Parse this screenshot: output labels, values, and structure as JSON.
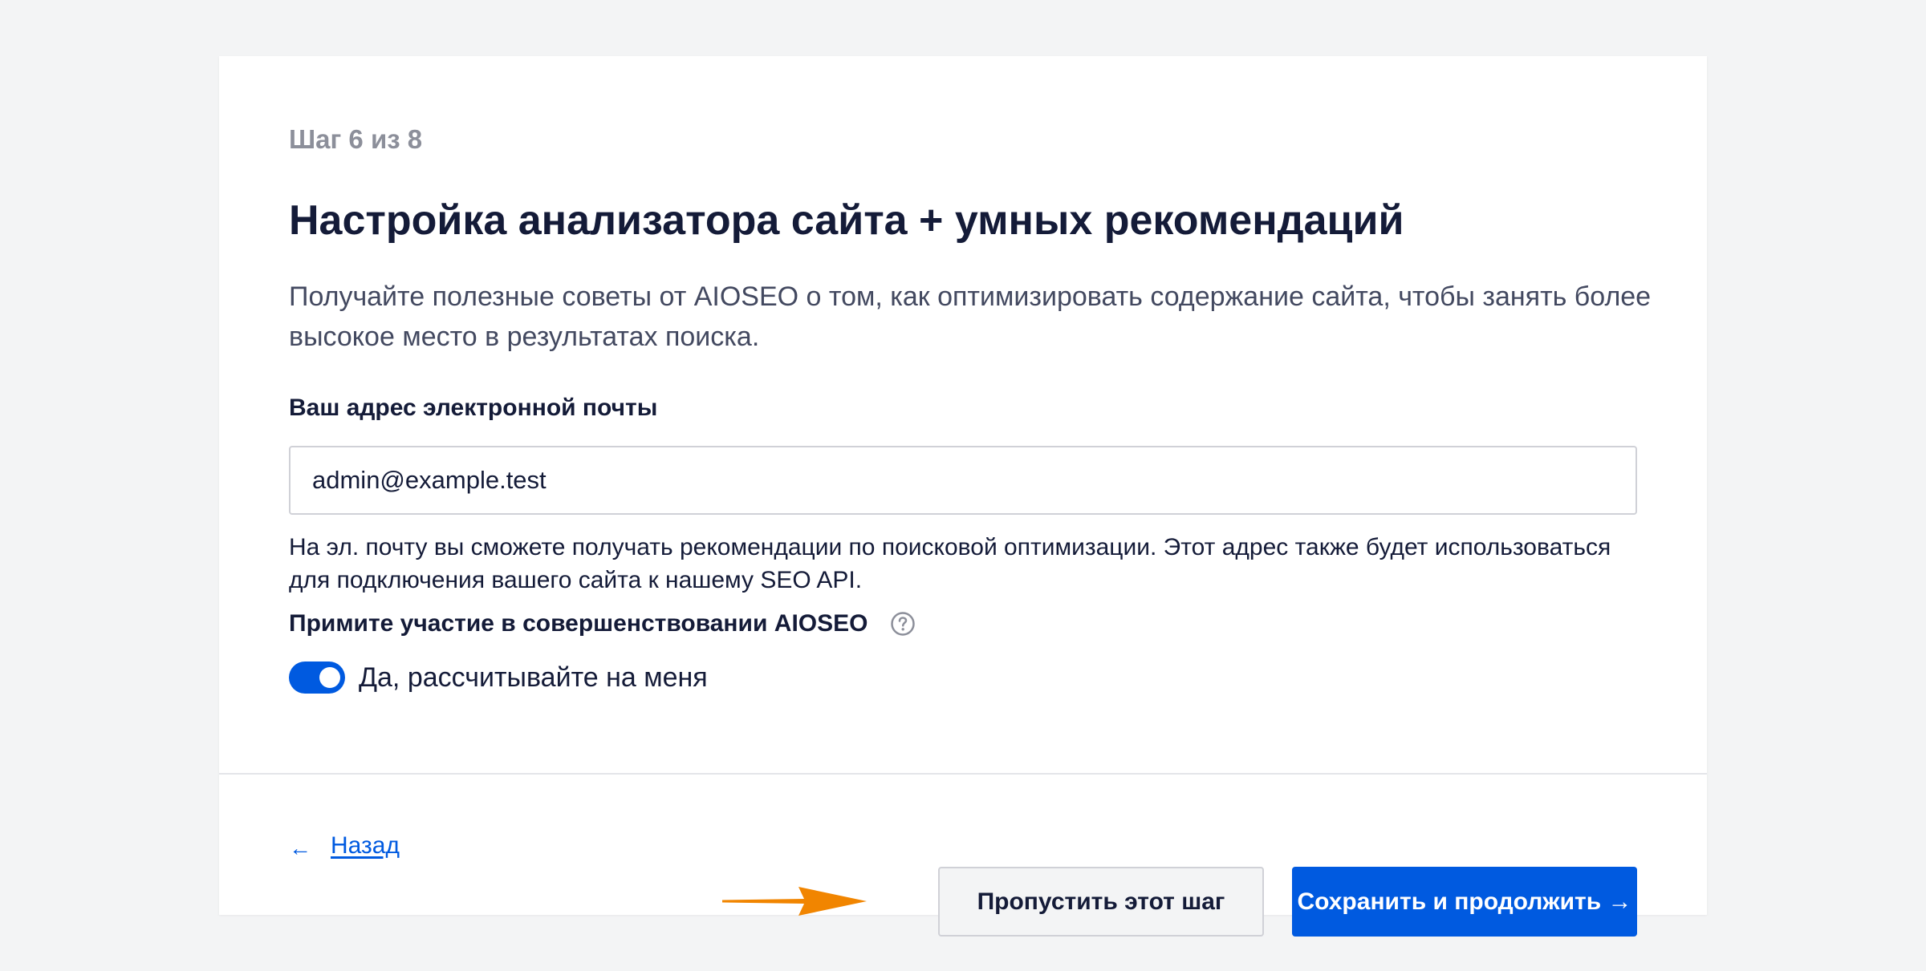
{
  "wizard": {
    "step_label": "Шаг 6 из 8",
    "title": "Настройка анализатора сайта + умных рекомендаций",
    "description": "Получайте полезные советы от AIOSEO о том, как оптимизировать содержание сайта, чтобы занять более высокое место в результатах поиска."
  },
  "email": {
    "label": "Ваш адрес электронной почты",
    "value": "admin@example.test",
    "hint": "На эл. почту вы сможете получать рекомендации по поисковой оптимизации. Этот адрес также будет использоваться для подключения вашего сайта к нашему SEO API."
  },
  "usage_tracking": {
    "label": "Примите участие в совершенствовании AIOSEO",
    "help_icon": "question-circle-icon",
    "toggle_on": true,
    "toggle_label": "Да, рассчитывайте на меня"
  },
  "footer": {
    "back_arrow": "←",
    "back_label": "Назад",
    "skip_label": "Пропустить этот шаг",
    "save_label": "Сохранить и продолжить →"
  },
  "colors": {
    "accent": "#005ae0",
    "annotation_arrow": "#f18500",
    "heading": "#141b38",
    "muted": "#8c8f9a"
  }
}
